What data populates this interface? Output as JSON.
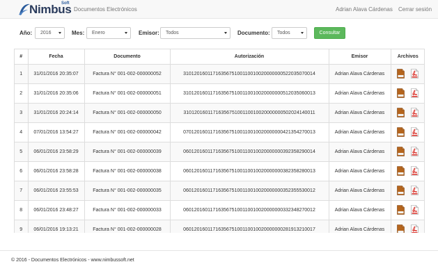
{
  "navbar": {
    "brand_name": "Nimbus",
    "brand_sub": "Soft",
    "title": "Documentos Electrónicos",
    "user": "Adrian Alava Cárdenas",
    "logout": "Cerrar sesión"
  },
  "filters": {
    "year_label": "Año:",
    "year_value": "2016",
    "month_label": "Mes:",
    "month_value": "Enero",
    "issuer_label": "Emisor:",
    "issuer_value": "Todos",
    "document_label": "Documento:",
    "document_value": "Todos",
    "submit_label": "Consultar"
  },
  "table": {
    "headers": [
      "#",
      "Fecha",
      "Documento",
      "Autorización",
      "Emisor",
      "Archivos"
    ],
    "file_icons": [
      "xml-file-icon",
      "pdf-file-icon"
    ],
    "rows": [
      [
        "1",
        "31/01/2016 20:35:07",
        "Factura N° 001-002-000000052",
        "3101201601171635675100110010020000000522035070014",
        "Adrian Alava Cárdenas"
      ],
      [
        "2",
        "31/01/2016 20:35:06",
        "Factura N° 001-002-000000051",
        "3101201601171635675100110010020000000512035060013",
        "Adrian Alava Cárdenas"
      ],
      [
        "3",
        "31/01/2016 20:24:14",
        "Factura N° 001-002-000000050",
        "3101201601171635675100110010020000000502024140011",
        "Adrian Alava Cárdenas"
      ],
      [
        "4",
        "07/01/2016 13:54:27",
        "Factura N° 001-002-000000042",
        "0701201601171635675100110010020000000421354270013",
        "Adrian Alava Cárdenas"
      ],
      [
        "5",
        "06/01/2016 23:58:29",
        "Factura N° 001-002-000000039",
        "0601201601171635675100110010020000000392358290014",
        "Adrian Alava Cárdenas"
      ],
      [
        "6",
        "06/01/2016 23:58:28",
        "Factura N° 001-002-000000038",
        "0601201601171635675100110010020000000382358280013",
        "Adrian Alava Cárdenas"
      ],
      [
        "7",
        "06/01/2016 23:55:53",
        "Factura N° 001-002-000000035",
        "0601201601171635675100110010020000000352355530012",
        "Adrian Alava Cárdenas"
      ],
      [
        "8",
        "06/01/2016 23:48:27",
        "Factura N° 001-002-000000033",
        "0601201601171635675100110010020000000332348270012",
        "Adrian Alava Cárdenas"
      ],
      [
        "9",
        "06/01/2016 19:13:21",
        "Factura N° 001-002-000000028",
        "0601201601171635675100110010020000000281913210017",
        "Adrian Alava Cárdenas"
      ]
    ]
  },
  "footer": {
    "text": "© 2016 - Documentos Electrónicos - www.nimbussoft.net"
  },
  "colors": {
    "navbar_bg": "#f8f8f8",
    "success": "#5cb85c",
    "pdf_red": "#d9322b",
    "xml_brown": "#b5651d"
  }
}
